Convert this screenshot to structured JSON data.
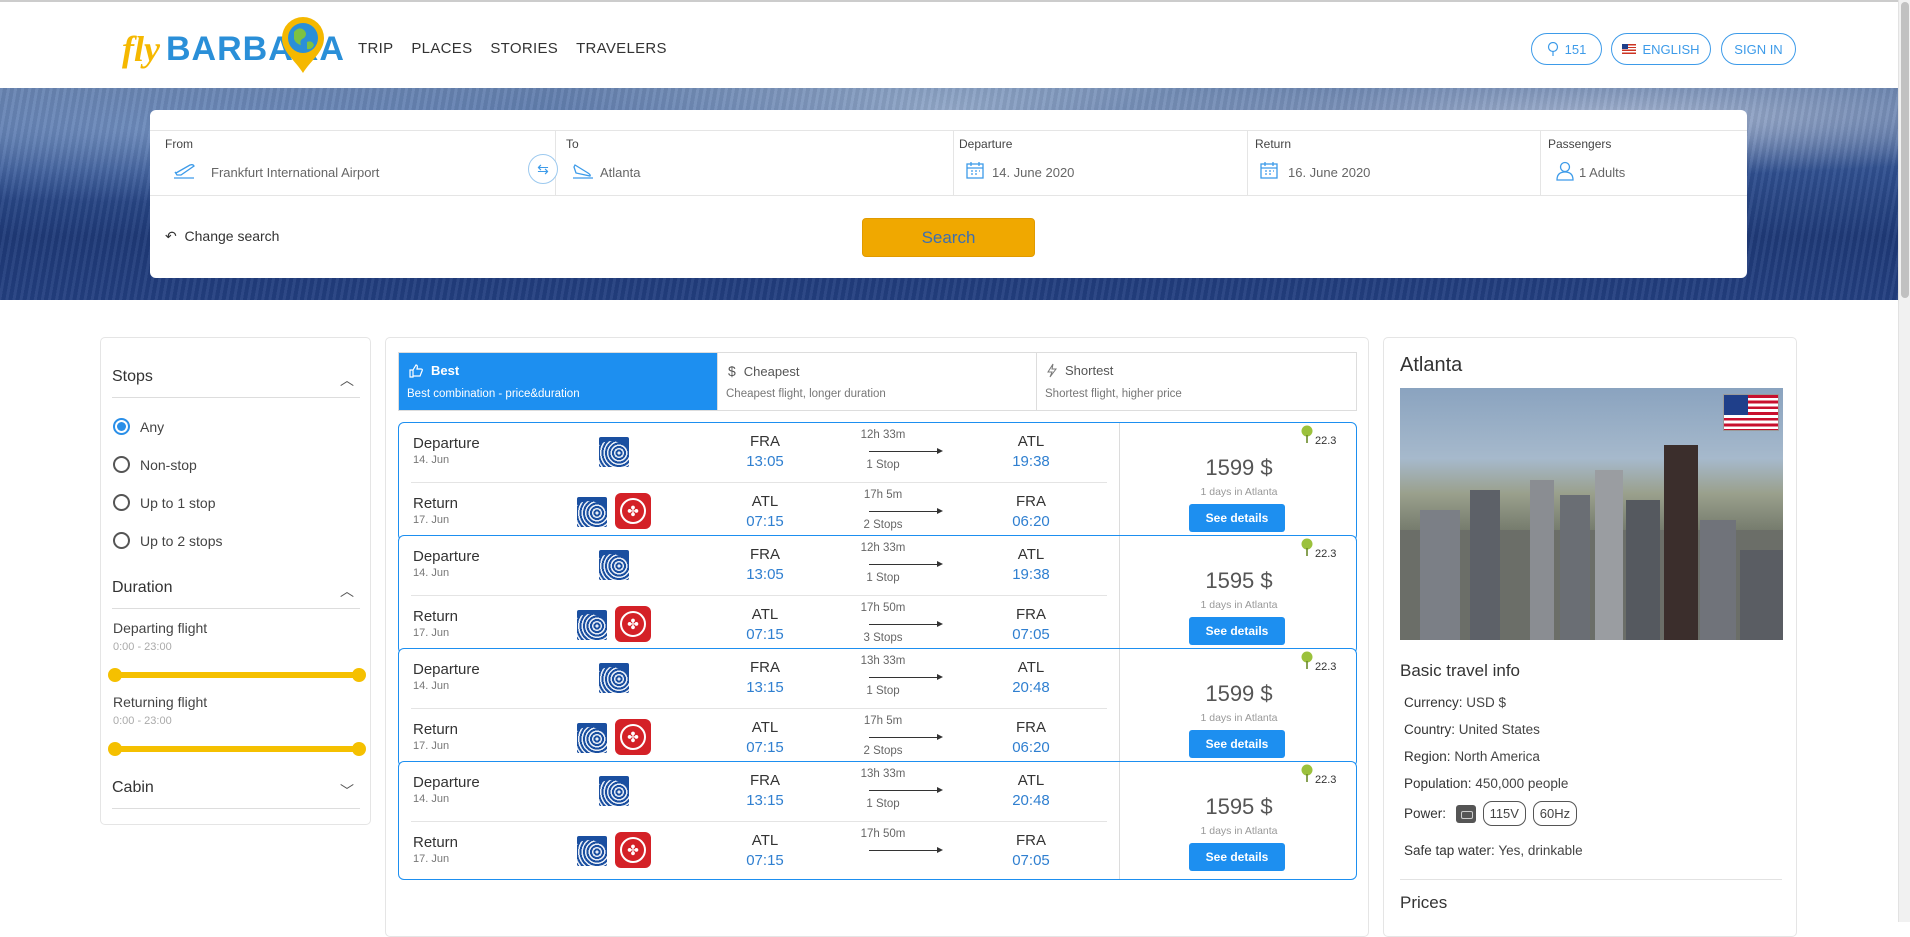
{
  "header": {
    "logo_fly": "fly",
    "logo_barbara": "BARBARA",
    "nav": [
      "TRIP",
      "PLACES",
      "STORIES",
      "TRAVELERS"
    ],
    "eco_count": "151",
    "language": "ENGLISH",
    "sign_in": "SIGN IN"
  },
  "search": {
    "from_label": "From",
    "from_value": "Frankfurt International Airport",
    "to_label": "To",
    "to_value": "Atlanta",
    "departure_label": "Departure",
    "departure_value": "14. June 2020",
    "return_label": "Return",
    "return_value": "16. June 2020",
    "passengers_label": "Passengers",
    "passengers_value": "1 Adults",
    "change_search": "Change search",
    "search_button": "Search"
  },
  "filters": {
    "stops_title": "Stops",
    "stops_options": [
      "Any",
      "Non-stop",
      "Up to 1 stop",
      "Up to 2 stops"
    ],
    "stops_selected": "Any",
    "duration_title": "Duration",
    "departing_label": "Departing flight",
    "departing_range": "0:00 - 23:00",
    "returning_label": "Returning flight",
    "returning_range": "0:00 - 23:00",
    "cabin_title": "Cabin"
  },
  "tabs": [
    {
      "title": "Best",
      "subtitle": "Best combination - price&duration",
      "icon": "thumbs-up-icon"
    },
    {
      "title": "Cheapest",
      "subtitle": "Cheapest flight, longer duration",
      "icon": "dollar-icon"
    },
    {
      "title": "Shortest",
      "subtitle": "Shortest flight, higher price",
      "icon": "lightning-icon"
    }
  ],
  "results": [
    {
      "departure": {
        "label": "Departure",
        "date": "14. Jun",
        "from": "FRA",
        "from_time": "13:05",
        "duration": "12h 33m",
        "stops": "1 Stop",
        "to": "ATL",
        "to_time": "19:38"
      },
      "return": {
        "label": "Return",
        "date": "17. Jun",
        "from": "ATL",
        "from_time": "07:15",
        "duration": "17h 5m",
        "stops": "2 Stops",
        "to": "FRA",
        "to_time": "06:20"
      },
      "price": "1599 $",
      "days": "1 days in Atlanta",
      "details": "See details",
      "eco": "22.3"
    },
    {
      "departure": {
        "label": "Departure",
        "date": "14. Jun",
        "from": "FRA",
        "from_time": "13:05",
        "duration": "12h 33m",
        "stops": "1 Stop",
        "to": "ATL",
        "to_time": "19:38"
      },
      "return": {
        "label": "Return",
        "date": "17. Jun",
        "from": "ATL",
        "from_time": "07:15",
        "duration": "17h 50m",
        "stops": "3 Stops",
        "to": "FRA",
        "to_time": "07:05"
      },
      "price": "1595 $",
      "days": "1 days in Atlanta",
      "details": "See details",
      "eco": "22.3"
    },
    {
      "departure": {
        "label": "Departure",
        "date": "14. Jun",
        "from": "FRA",
        "from_time": "13:15",
        "duration": "13h 33m",
        "stops": "1 Stop",
        "to": "ATL",
        "to_time": "20:48"
      },
      "return": {
        "label": "Return",
        "date": "17. Jun",
        "from": "ATL",
        "from_time": "07:15",
        "duration": "17h 5m",
        "stops": "2 Stops",
        "to": "FRA",
        "to_time": "06:20"
      },
      "price": "1599 $",
      "days": "1 days in Atlanta",
      "details": "See details",
      "eco": "22.3"
    },
    {
      "departure": {
        "label": "Departure",
        "date": "14. Jun",
        "from": "FRA",
        "from_time": "13:15",
        "duration": "13h 33m",
        "stops": "1 Stop",
        "to": "ATL",
        "to_time": "20:48"
      },
      "return": {
        "label": "Return",
        "date": "17. Jun",
        "from": "ATL",
        "from_time": "07:15",
        "duration": "17h 50m",
        "stops": "",
        "to": "FRA",
        "to_time": "07:05"
      },
      "price": "1595 $",
      "days": "1 days in Atlanta",
      "details": "See details",
      "eco": "22.3"
    }
  ],
  "city": {
    "name": "Atlanta",
    "basic_info_title": "Basic travel info",
    "currency_label": "Currency:",
    "currency": "USD $",
    "country_label": "Country:",
    "country": "United States",
    "region_label": "Region:",
    "region": "North America",
    "population_label": "Population:",
    "population": "450,000 people",
    "power_label": "Power:",
    "voltage": "115V",
    "frequency": "60Hz",
    "water_label": "Safe tap water:",
    "water": "Yes, drinkable",
    "prices_title": "Prices"
  },
  "colors": {
    "accent": "#1d8ff0",
    "search_button": "#f0a800",
    "slider": "#f5c000",
    "air_canada": "#d42127",
    "united": "#1a4fa0"
  }
}
